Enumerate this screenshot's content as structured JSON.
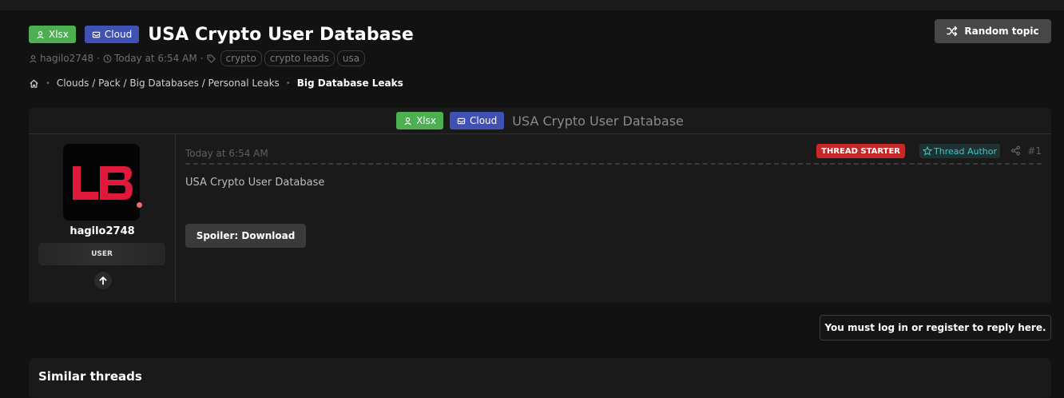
{
  "thread": {
    "prefix_badges": [
      {
        "label": "Xlsx",
        "color": "#4caf50",
        "icon": "user-icon"
      },
      {
        "label": "Cloud",
        "color": "#3f51b5",
        "icon": "inbox-icon"
      }
    ],
    "title": "USA Crypto User Database",
    "author": "hagilo2748",
    "time": "Today at 6:54 AM",
    "tags": [
      "crypto",
      "crypto leads",
      "usa"
    ]
  },
  "toolbar": {
    "random_topic_label": "Random topic"
  },
  "breadcrumb": {
    "home_icon": "home-icon",
    "items": [
      "Clouds / Pack / Big Databases / Personal Leaks",
      "Big Database Leaks"
    ]
  },
  "post": {
    "user": {
      "avatar_text": "LB",
      "username": "hagilo2748",
      "user_title": "USER",
      "online_color": "#ef6b6b"
    },
    "date": "Today at 6:54 AM",
    "thread_starter_label": "THREAD STARTER",
    "thread_author_label": "Thread Author",
    "post_number": "#1",
    "body": "USA Crypto User Database",
    "spoiler_label": "Spoiler: Download"
  },
  "reply_notice": "You must log in or register to reply here.",
  "similar": {
    "title": "Similar threads"
  },
  "colors": {
    "background": "#121212",
    "panel": "#1a1a1a",
    "thread_starter": "#c62828",
    "thread_author": "#3cc9c9",
    "avatar_logo": "#e0183a"
  }
}
